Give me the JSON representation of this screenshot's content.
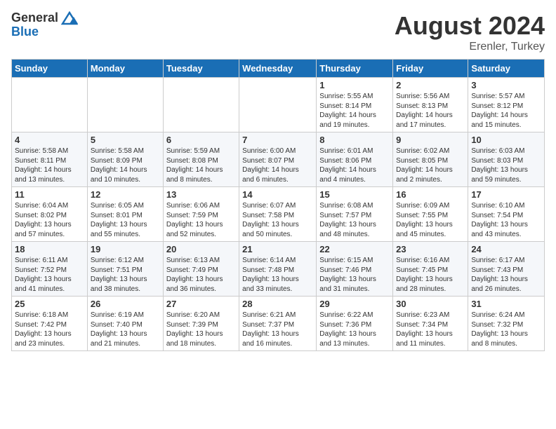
{
  "header": {
    "logo_general": "General",
    "logo_blue": "Blue",
    "main_title": "August 2024",
    "subtitle": "Erenler, Turkey"
  },
  "weekdays": [
    "Sunday",
    "Monday",
    "Tuesday",
    "Wednesday",
    "Thursday",
    "Friday",
    "Saturday"
  ],
  "rows": [
    [
      {
        "day": "",
        "info": ""
      },
      {
        "day": "",
        "info": ""
      },
      {
        "day": "",
        "info": ""
      },
      {
        "day": "",
        "info": ""
      },
      {
        "day": "1",
        "info": "Sunrise: 5:55 AM\nSunset: 8:14 PM\nDaylight: 14 hours\nand 19 minutes."
      },
      {
        "day": "2",
        "info": "Sunrise: 5:56 AM\nSunset: 8:13 PM\nDaylight: 14 hours\nand 17 minutes."
      },
      {
        "day": "3",
        "info": "Sunrise: 5:57 AM\nSunset: 8:12 PM\nDaylight: 14 hours\nand 15 minutes."
      }
    ],
    [
      {
        "day": "4",
        "info": "Sunrise: 5:58 AM\nSunset: 8:11 PM\nDaylight: 14 hours\nand 13 minutes."
      },
      {
        "day": "5",
        "info": "Sunrise: 5:58 AM\nSunset: 8:09 PM\nDaylight: 14 hours\nand 10 minutes."
      },
      {
        "day": "6",
        "info": "Sunrise: 5:59 AM\nSunset: 8:08 PM\nDaylight: 14 hours\nand 8 minutes."
      },
      {
        "day": "7",
        "info": "Sunrise: 6:00 AM\nSunset: 8:07 PM\nDaylight: 14 hours\nand 6 minutes."
      },
      {
        "day": "8",
        "info": "Sunrise: 6:01 AM\nSunset: 8:06 PM\nDaylight: 14 hours\nand 4 minutes."
      },
      {
        "day": "9",
        "info": "Sunrise: 6:02 AM\nSunset: 8:05 PM\nDaylight: 14 hours\nand 2 minutes."
      },
      {
        "day": "10",
        "info": "Sunrise: 6:03 AM\nSunset: 8:03 PM\nDaylight: 13 hours\nand 59 minutes."
      }
    ],
    [
      {
        "day": "11",
        "info": "Sunrise: 6:04 AM\nSunset: 8:02 PM\nDaylight: 13 hours\nand 57 minutes."
      },
      {
        "day": "12",
        "info": "Sunrise: 6:05 AM\nSunset: 8:01 PM\nDaylight: 13 hours\nand 55 minutes."
      },
      {
        "day": "13",
        "info": "Sunrise: 6:06 AM\nSunset: 7:59 PM\nDaylight: 13 hours\nand 52 minutes."
      },
      {
        "day": "14",
        "info": "Sunrise: 6:07 AM\nSunset: 7:58 PM\nDaylight: 13 hours\nand 50 minutes."
      },
      {
        "day": "15",
        "info": "Sunrise: 6:08 AM\nSunset: 7:57 PM\nDaylight: 13 hours\nand 48 minutes."
      },
      {
        "day": "16",
        "info": "Sunrise: 6:09 AM\nSunset: 7:55 PM\nDaylight: 13 hours\nand 45 minutes."
      },
      {
        "day": "17",
        "info": "Sunrise: 6:10 AM\nSunset: 7:54 PM\nDaylight: 13 hours\nand 43 minutes."
      }
    ],
    [
      {
        "day": "18",
        "info": "Sunrise: 6:11 AM\nSunset: 7:52 PM\nDaylight: 13 hours\nand 41 minutes."
      },
      {
        "day": "19",
        "info": "Sunrise: 6:12 AM\nSunset: 7:51 PM\nDaylight: 13 hours\nand 38 minutes."
      },
      {
        "day": "20",
        "info": "Sunrise: 6:13 AM\nSunset: 7:49 PM\nDaylight: 13 hours\nand 36 minutes."
      },
      {
        "day": "21",
        "info": "Sunrise: 6:14 AM\nSunset: 7:48 PM\nDaylight: 13 hours\nand 33 minutes."
      },
      {
        "day": "22",
        "info": "Sunrise: 6:15 AM\nSunset: 7:46 PM\nDaylight: 13 hours\nand 31 minutes."
      },
      {
        "day": "23",
        "info": "Sunrise: 6:16 AM\nSunset: 7:45 PM\nDaylight: 13 hours\nand 28 minutes."
      },
      {
        "day": "24",
        "info": "Sunrise: 6:17 AM\nSunset: 7:43 PM\nDaylight: 13 hours\nand 26 minutes."
      }
    ],
    [
      {
        "day": "25",
        "info": "Sunrise: 6:18 AM\nSunset: 7:42 PM\nDaylight: 13 hours\nand 23 minutes."
      },
      {
        "day": "26",
        "info": "Sunrise: 6:19 AM\nSunset: 7:40 PM\nDaylight: 13 hours\nand 21 minutes."
      },
      {
        "day": "27",
        "info": "Sunrise: 6:20 AM\nSunset: 7:39 PM\nDaylight: 13 hours\nand 18 minutes."
      },
      {
        "day": "28",
        "info": "Sunrise: 6:21 AM\nSunset: 7:37 PM\nDaylight: 13 hours\nand 16 minutes."
      },
      {
        "day": "29",
        "info": "Sunrise: 6:22 AM\nSunset: 7:36 PM\nDaylight: 13 hours\nand 13 minutes."
      },
      {
        "day": "30",
        "info": "Sunrise: 6:23 AM\nSunset: 7:34 PM\nDaylight: 13 hours\nand 11 minutes."
      },
      {
        "day": "31",
        "info": "Sunrise: 6:24 AM\nSunset: 7:32 PM\nDaylight: 13 hours\nand 8 minutes."
      }
    ]
  ]
}
